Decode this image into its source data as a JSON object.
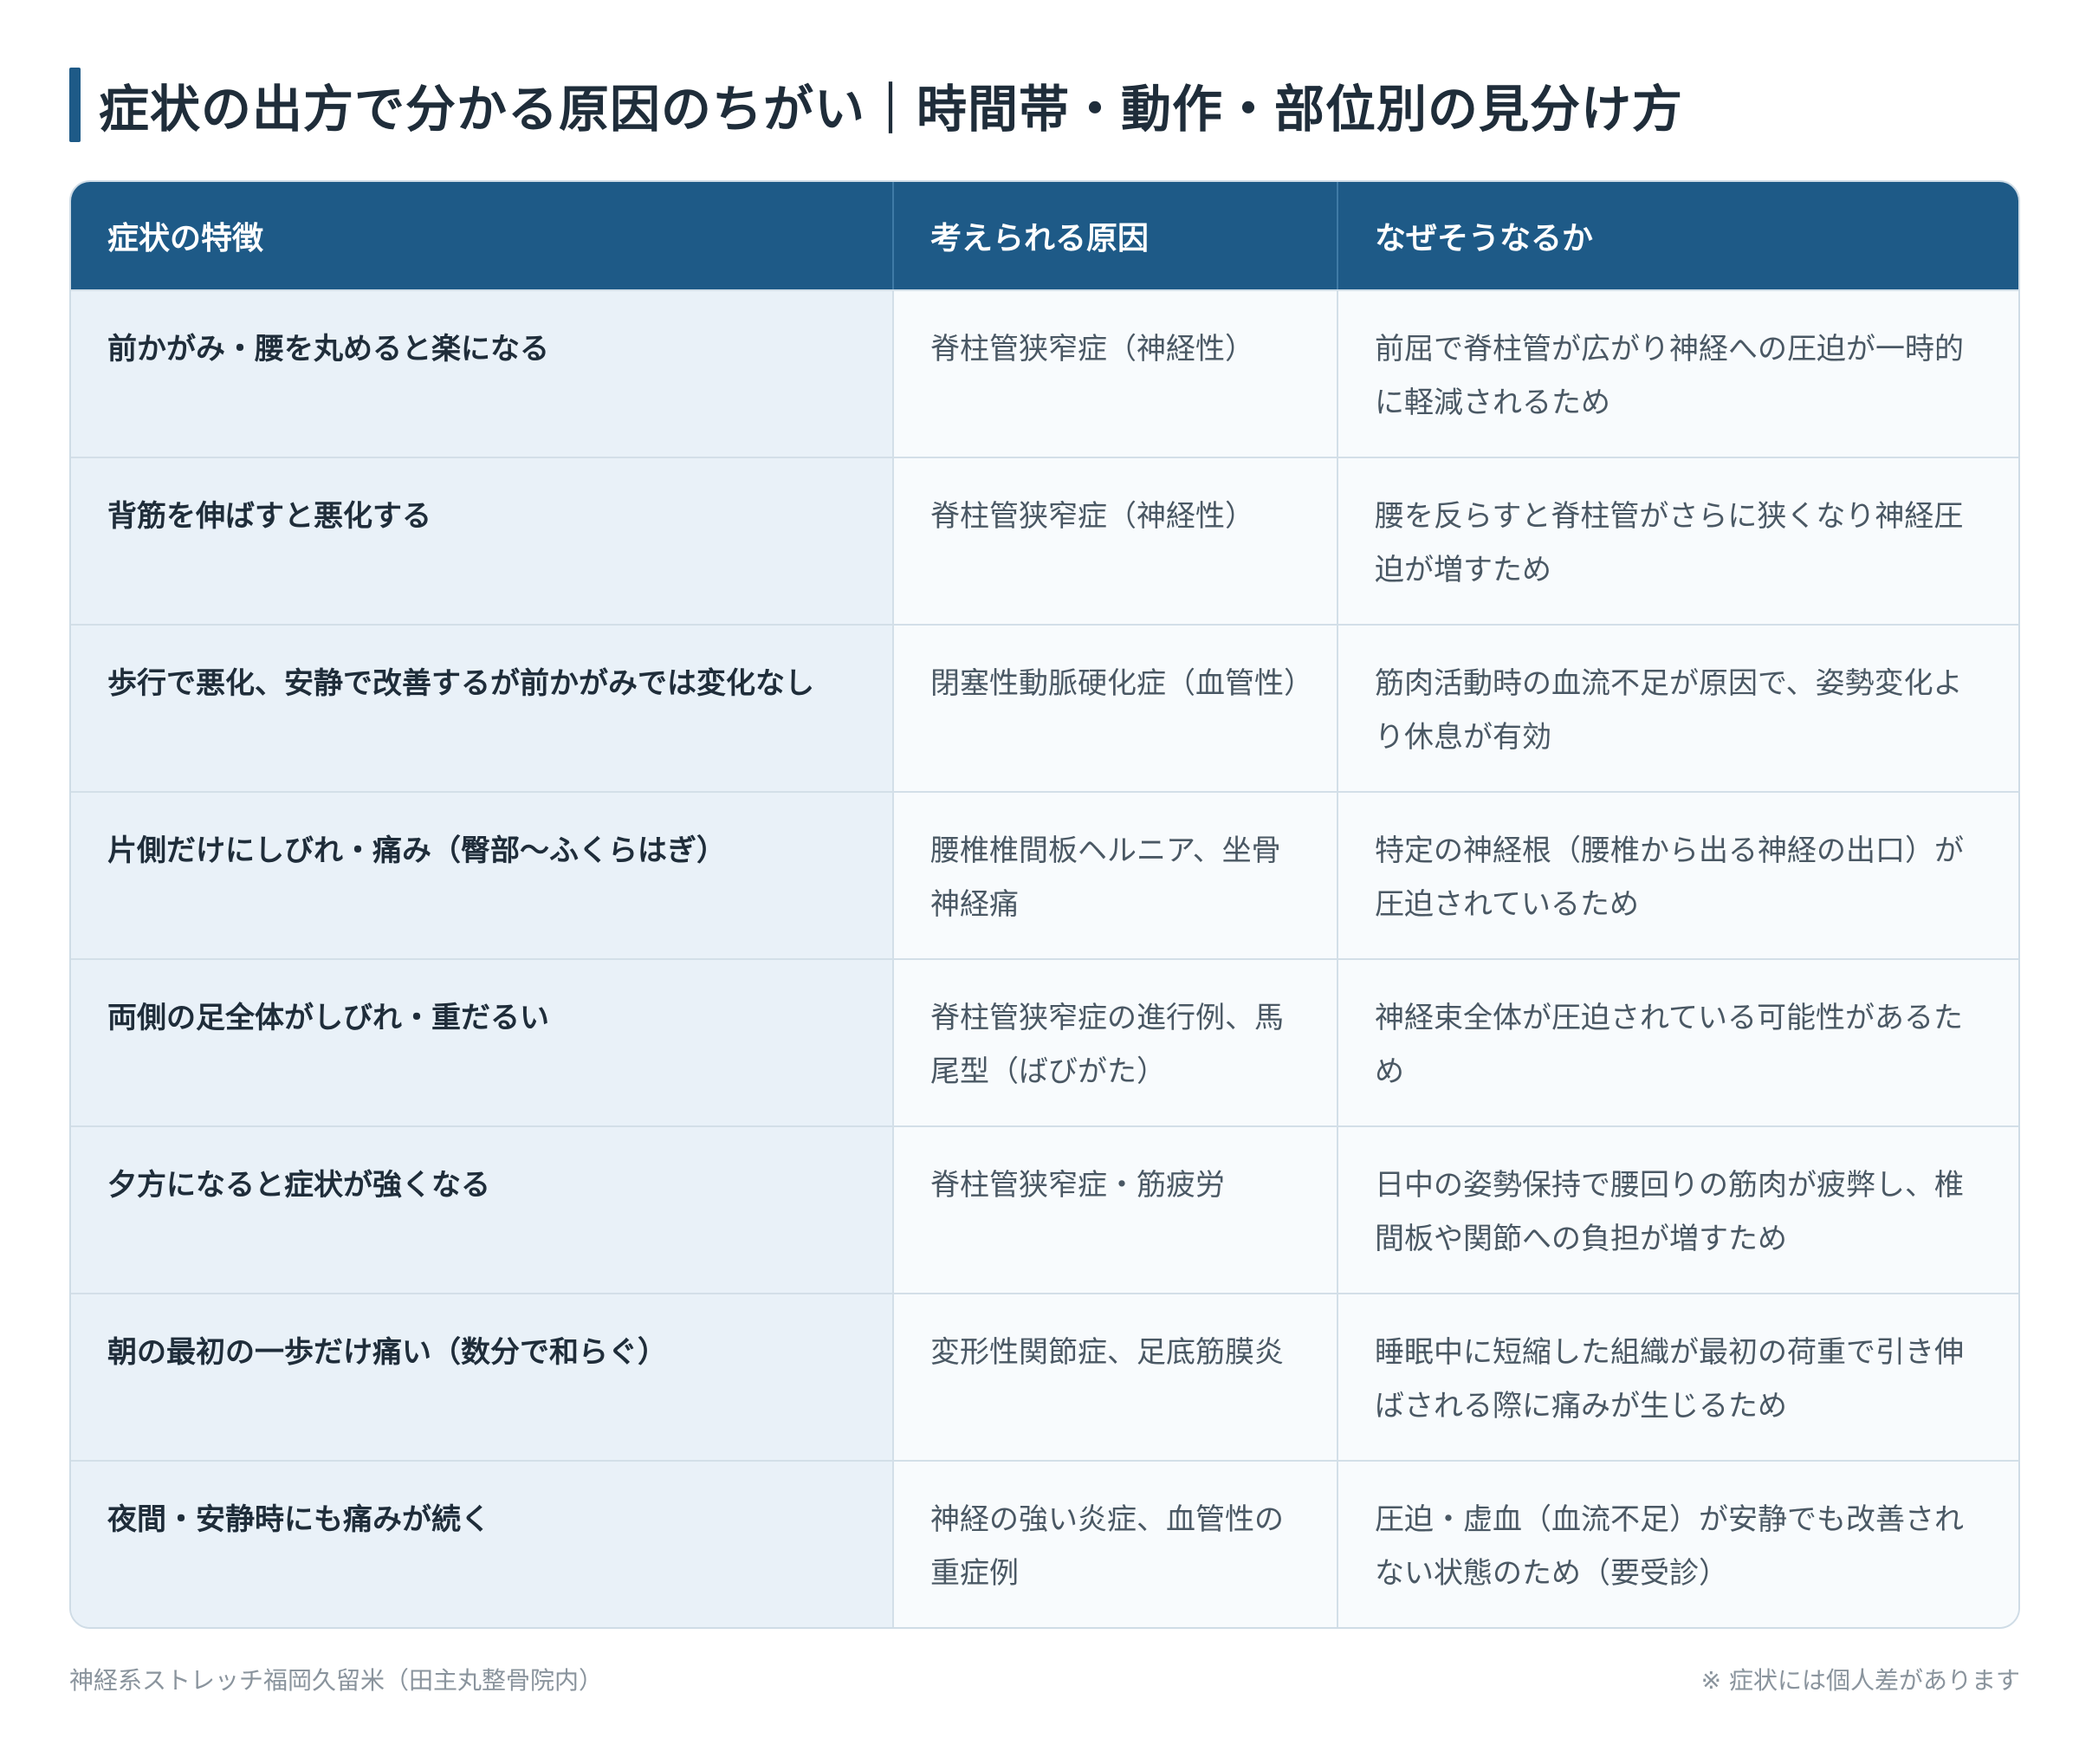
{
  "title": "症状の出方で分かる原因のちがい｜時間帯・動作・部位別の見分け方",
  "colors": {
    "accent": "#1e5a87",
    "symptom_bg": "#e9f1f8",
    "cell_bg": "#f8fbfd"
  },
  "table": {
    "headers": [
      "症状の特徴",
      "考えられる原因",
      "なぜそうなるか"
    ],
    "rows": [
      {
        "symptom": "前かがみ・腰を丸めると楽になる",
        "cause": "脊柱管狭窄症（神経性）",
        "reason": "前屈で脊柱管が広がり神経への圧迫が一時的に軽減されるため"
      },
      {
        "symptom": "背筋を伸ばすと悪化する",
        "cause": "脊柱管狭窄症（神経性）",
        "reason": "腰を反らすと脊柱管がさらに狭くなり神経圧迫が増すため"
      },
      {
        "symptom": "歩行で悪化、安静で改善するが前かがみでは変化なし",
        "cause": "閉塞性動脈硬化症（血管性）",
        "reason": "筋肉活動時の血流不足が原因で、姿勢変化より休息が有効"
      },
      {
        "symptom": "片側だけにしびれ・痛み（臀部〜ふくらはぎ）",
        "cause": "腰椎椎間板ヘルニア、坐骨神経痛",
        "reason": "特定の神経根（腰椎から出る神経の出口）が圧迫されているため"
      },
      {
        "symptom": "両側の足全体がしびれ・重だるい",
        "cause": "脊柱管狭窄症の進行例、馬尾型（ばびがた）",
        "reason": "神経束全体が圧迫されている可能性があるため"
      },
      {
        "symptom": "夕方になると症状が強くなる",
        "cause": "脊柱管狭窄症・筋疲労",
        "reason": "日中の姿勢保持で腰回りの筋肉が疲弊し、椎間板や関節への負担が増すため"
      },
      {
        "symptom": "朝の最初の一歩だけ痛い（数分で和らぐ）",
        "cause": "変形性関節症、足底筋膜炎",
        "reason": "睡眠中に短縮した組織が最初の荷重で引き伸ばされる際に痛みが生じるため"
      },
      {
        "symptom": "夜間・安静時にも痛みが続く",
        "cause": "神経の強い炎症、血管性の重症例",
        "reason": "圧迫・虚血（血流不足）が安静でも改善されない状態のため（要受診）"
      }
    ]
  },
  "footer": {
    "left": "神経系ストレッチ福岡久留米（田主丸整骨院内）",
    "right": "※ 症状には個人差があります"
  }
}
